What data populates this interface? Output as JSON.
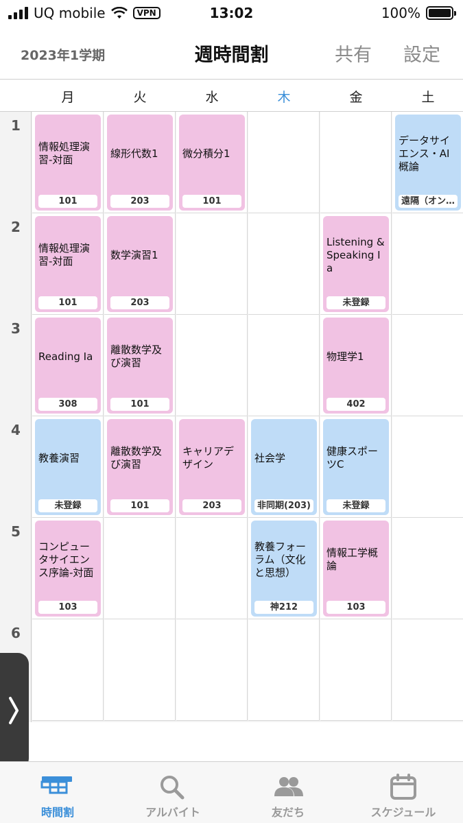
{
  "status_bar": {
    "carrier": "UQ mobile",
    "vpn": "VPN",
    "time": "13:02",
    "battery": "100%"
  },
  "header": {
    "term": "2023年1学期",
    "title": "週時間割",
    "share": "共有",
    "settings": "設定"
  },
  "days": [
    "月",
    "火",
    "水",
    "木",
    "金",
    "土"
  ],
  "today_index": 3,
  "periods": [
    "1",
    "2",
    "3",
    "4",
    "5",
    "6"
  ],
  "courses": [
    {
      "period": 1,
      "day": 0,
      "name": "情報処理演習-対面",
      "room": "101",
      "color": "pink"
    },
    {
      "period": 1,
      "day": 1,
      "name": "線形代数1",
      "room": "203",
      "color": "pink"
    },
    {
      "period": 1,
      "day": 2,
      "name": "微分積分1",
      "room": "101",
      "color": "pink"
    },
    {
      "period": 1,
      "day": 5,
      "name": "データサイエンス・AI概論",
      "room": "遠隔（オン…",
      "color": "blue"
    },
    {
      "period": 2,
      "day": 0,
      "name": "情報処理演習-対面",
      "room": "101",
      "color": "pink"
    },
    {
      "period": 2,
      "day": 1,
      "name": "数学演習1",
      "room": "203",
      "color": "pink"
    },
    {
      "period": 2,
      "day": 4,
      "name": "Listening & Speaking Ia",
      "room": "未登録",
      "color": "pink"
    },
    {
      "period": 3,
      "day": 0,
      "name": "Reading Ia",
      "room": "308",
      "color": "pink"
    },
    {
      "period": 3,
      "day": 1,
      "name": "離散数学及び演習",
      "room": "101",
      "color": "pink"
    },
    {
      "period": 3,
      "day": 4,
      "name": "物理学1",
      "room": "402",
      "color": "pink"
    },
    {
      "period": 4,
      "day": 0,
      "name": "教養演習",
      "room": "未登録",
      "color": "blue"
    },
    {
      "period": 4,
      "day": 1,
      "name": "離散数学及び演習",
      "room": "101",
      "color": "pink"
    },
    {
      "period": 4,
      "day": 2,
      "name": "キャリアデザイン",
      "room": "203",
      "color": "pink"
    },
    {
      "period": 4,
      "day": 3,
      "name": "社会学",
      "room": "非同期(203)",
      "color": "blue"
    },
    {
      "period": 4,
      "day": 4,
      "name": "健康スポーツC",
      "room": "未登録",
      "color": "blue"
    },
    {
      "period": 5,
      "day": 0,
      "name": "コンピュータサイエンス序論-対面",
      "room": "103",
      "color": "pink"
    },
    {
      "period": 5,
      "day": 3,
      "name": "教養フォーラム（文化と思想）",
      "room": "神212",
      "color": "blue"
    },
    {
      "period": 5,
      "day": 4,
      "name": "情報工学概論",
      "room": "103",
      "color": "pink"
    }
  ],
  "tabs": [
    {
      "label": "時間割",
      "icon": "timetable-icon",
      "active": true
    },
    {
      "label": "アルバイト",
      "icon": "search-icon",
      "active": false
    },
    {
      "label": "友だち",
      "icon": "friends-icon",
      "active": false
    },
    {
      "label": "スケジュール",
      "icon": "calendar-icon",
      "active": false
    }
  ],
  "colors": {
    "accent": "#3b8fd9",
    "pink_course": "#f1c2e3",
    "blue_course": "#bfdcf7"
  }
}
